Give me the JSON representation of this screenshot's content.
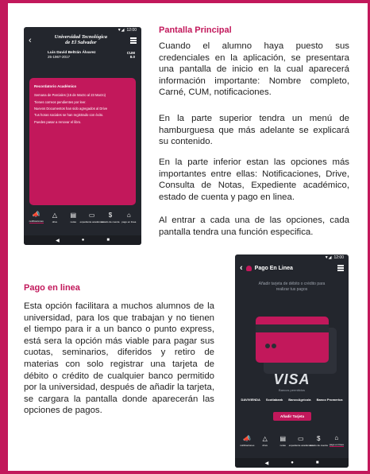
{
  "section1": {
    "heading": "Pantalla Principal",
    "paragraphs": [
      "Cuando el alumno haya puesto sus credenciales en la aplicación, se presentara una pantalla de inicio en la cual aparecerá información importante: Nombre completo, Carné, CUM, notificaciones.",
      "En la parte superior tendra un menú de hamburguesa que más adelante se explicará su contenido.",
      "En la parte inferior estan las opciones más importantes entre ellas: Notificaciones, Drive, Consulta de Notas, Expediente académico, estado de cuenta y pago en linea.",
      "Al entrar a cada una de las opciones, cada pantalla tendra una función especifica."
    ]
  },
  "section2": {
    "heading": "Pago en linea",
    "paragraph": "Esta opción facilitara a muchos alumnos de la universidad, para los que trabajan y no tienen el tiempo para ir a un banco o punto express, está sera la opción más viable para pagar sus cuotas, seminarios, diferidos y retiro de materias con solo registrar una tarjeta de débito o crédito de cualquier banco permitido por la universidad, después de añadir la tarjeta, se cargara la pantalla donde aparecerán las opciones de pagos."
  },
  "phone1": {
    "time": "12:00",
    "logo_line1": "Universidad Tecnológica",
    "logo_line2": "de El Salvador",
    "student_name": "Luis David Beltrán Álvarez",
    "carne": "25-1967-2017",
    "cum_label": "CUM",
    "cum_value": "8.0",
    "notif_title": "Recordatorio Académico",
    "notif_items": [
      "Semana de Parciales (15 de Marzo al 23 Marzo)",
      "Tienes correos pendientes por leer.",
      "Nuevos Documentos han sido agregados al Drive",
      "Tus horas sociales se han registrado con éxito.",
      "Puedes pasar a renovar el libro."
    ],
    "tabs": [
      "notificaciones",
      "drive",
      "notas",
      "expediente académico",
      "estado de cuenta",
      "pago en linea"
    ]
  },
  "phone2": {
    "time": "12:00",
    "title": "Pago En Linea",
    "subtitle": "Añadir tarjeta de débito o crédito para realizar tus pagos",
    "visa": "VISA",
    "accepted": "Bancos permitidos",
    "banks": [
      "DAVIVIENDA",
      "Scotiabank",
      "BancoAgrícola",
      "Banco Promerica"
    ],
    "add_button": "Añadir Tarjeta",
    "tabs": [
      "notificaciones",
      "drive",
      "notas",
      "expediente académico",
      "estado de cuenta",
      "pago en linea"
    ]
  },
  "colors": {
    "accent": "#c2185b",
    "phone_bg": "#23262d"
  }
}
